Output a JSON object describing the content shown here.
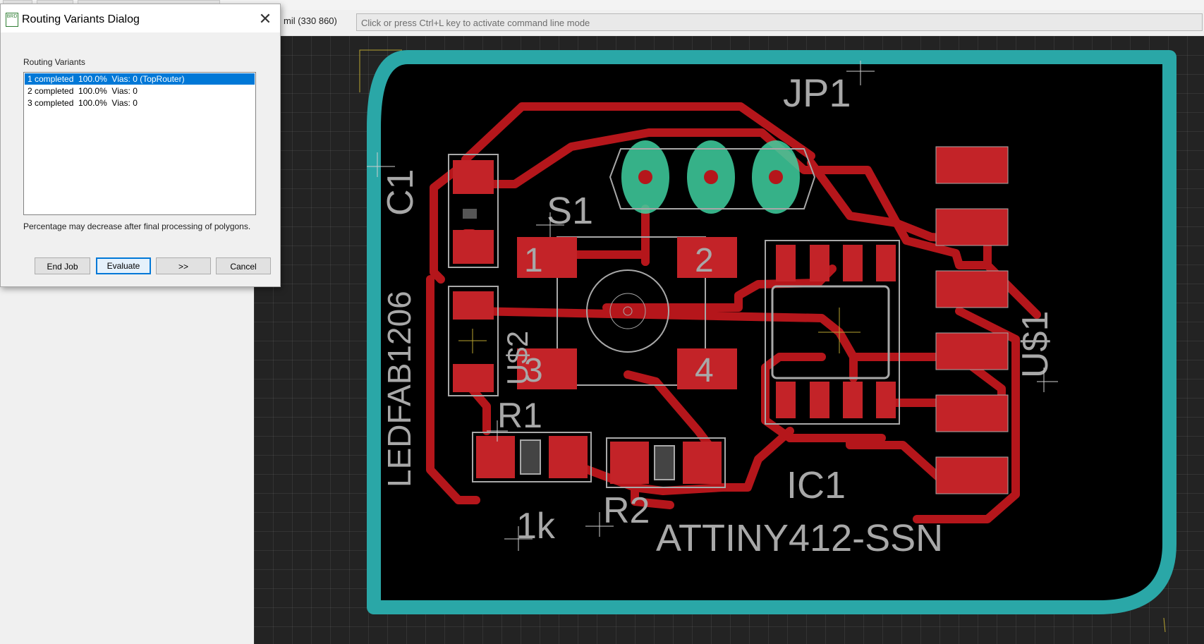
{
  "toolbar": {
    "coordinate": "mil (330 860)",
    "command_placeholder": "Click or press Ctrl+L key to activate command line mode"
  },
  "dialog": {
    "icon_label": "BRD",
    "title": "Routing Variants Dialog",
    "list_label": "Routing Variants",
    "variants": [
      {
        "text": "1 completed  100.0%  Vias: 0 (TopRouter)",
        "selected": true
      },
      {
        "text": "2 completed  100.0%  Vias: 0",
        "selected": false
      },
      {
        "text": "3 completed  100.0%  Vias: 0",
        "selected": false
      }
    ],
    "note": "Percentage may decrease after final processing of polygons.",
    "buttons": {
      "end_job": "End Job",
      "evaluate": "Evaluate",
      "next": ">>",
      "cancel": "Cancel"
    }
  },
  "board": {
    "labels": {
      "jp1": "JP1",
      "c1": "C1",
      "s1": "S1",
      "pad1": "1",
      "pad2": "2",
      "pad3": "3",
      "pad4": "4",
      "ledfab": "LEDFAB1206",
      "us2": "U$2",
      "r1": "R1",
      "r1_value": "1k",
      "r2": "R2",
      "ic1": "IC1",
      "ic1_value": "ATTINY412-SSN",
      "us1": "U$1"
    },
    "colors": {
      "background": "#232323",
      "board_fill": "#000000",
      "outline": "#2aa7a7",
      "copper": "#b5161b",
      "silkscreen": "#a8a8a8",
      "pads_through_hole": "#3fd0a0"
    }
  }
}
